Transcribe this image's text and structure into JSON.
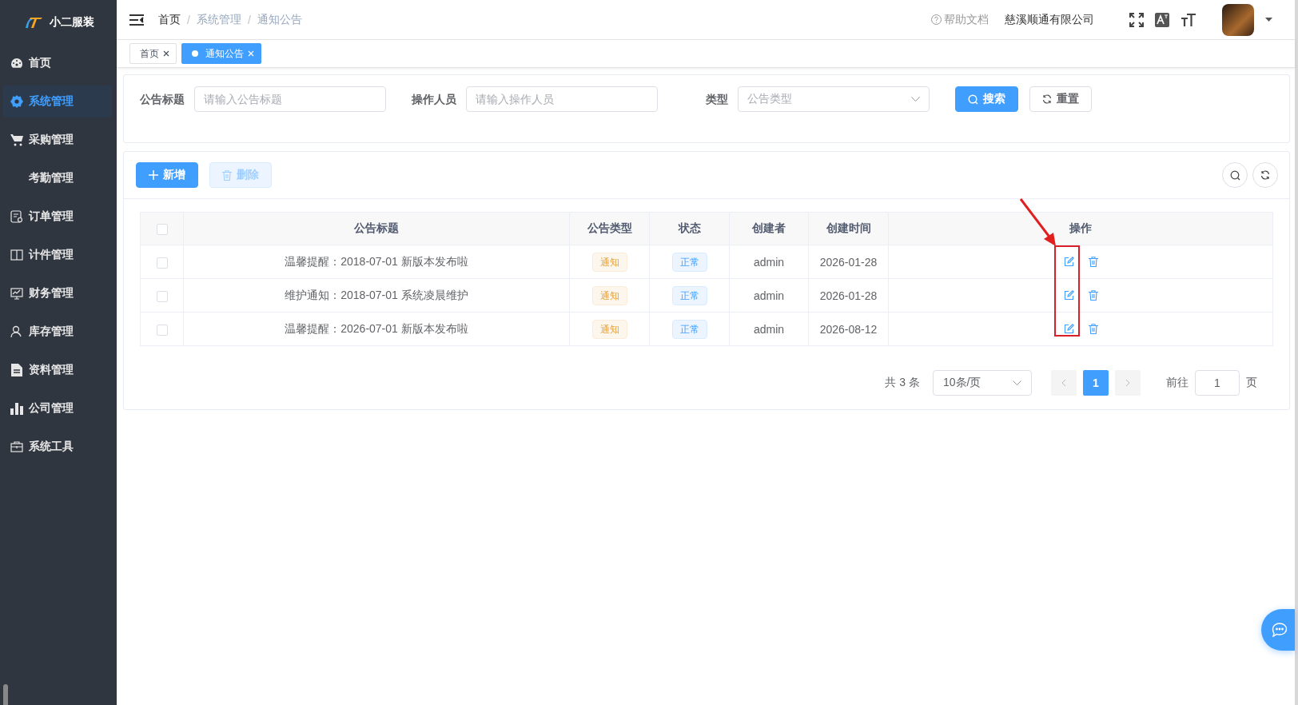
{
  "sidebar": {
    "logo_text": "小二服装",
    "items": [
      {
        "label": "首页",
        "selected": false
      },
      {
        "label": "系统管理",
        "selected": true
      },
      {
        "label": "采购管理",
        "selected": false
      },
      {
        "label": "考勤管理",
        "selected": false
      },
      {
        "label": "订单管理",
        "selected": false
      },
      {
        "label": "计件管理",
        "selected": false
      },
      {
        "label": "财务管理",
        "selected": false
      },
      {
        "label": "库存管理",
        "selected": false
      },
      {
        "label": "资料管理",
        "selected": false
      },
      {
        "label": "公司管理",
        "selected": false
      },
      {
        "label": "系统工具",
        "selected": false
      }
    ]
  },
  "header": {
    "breadcrumb": [
      {
        "label": "首页",
        "link": true
      },
      {
        "label": "系统管理",
        "link": false
      },
      {
        "label": "通知公告",
        "link": false
      }
    ],
    "separator": "/",
    "help": "帮助文档",
    "company": "慈溪顺通有限公司"
  },
  "tabs": [
    {
      "label": "首页",
      "selected": false
    },
    {
      "label": "通知公告",
      "selected": true
    }
  ],
  "filters": [
    {
      "kind": "input",
      "label": "公告标题",
      "placeholder": "请输入公告标题"
    },
    {
      "kind": "input",
      "label": "操作人员",
      "placeholder": "请输入操作人员"
    },
    {
      "kind": "select",
      "label": "类型",
      "placeholder": "公告类型"
    }
  ],
  "filter_buttons": [
    {
      "kind": "search",
      "label": "搜索"
    },
    {
      "kind": "reset",
      "label": "重置"
    }
  ],
  "toolbar": [
    {
      "kind": "add",
      "label": "新增",
      "disabled": false
    },
    {
      "kind": "delete",
      "label": "删除",
      "disabled": true
    }
  ],
  "table": {
    "columns": [
      "公告标题",
      "公告类型",
      "状态",
      "创建者",
      "创建时间",
      "操作"
    ],
    "header_checked": false,
    "rows": [
      {
        "checked": false,
        "title": "温馨提醒：2018-07-01 新版本发布啦",
        "type": "通知",
        "status": "正常",
        "creator": "admin",
        "created": "2026-01-28"
      },
      {
        "checked": false,
        "title": "维护通知：2018-07-01 系统凌晨维护",
        "type": "通知",
        "status": "正常",
        "creator": "admin",
        "created": "2026-01-28"
      },
      {
        "checked": false,
        "title": "温馨提醒：2026-07-01 新版本发布啦",
        "type": "通知",
        "status": "正常",
        "creator": "admin",
        "created": "2026-08-12"
      }
    ]
  },
  "pagination": {
    "total": "共 3 条",
    "page_size": "10条/页",
    "pages": [
      {
        "label": "1",
        "selected": true
      }
    ],
    "goto_label": "前往",
    "goto_value": "1",
    "page_suffix": "页"
  }
}
